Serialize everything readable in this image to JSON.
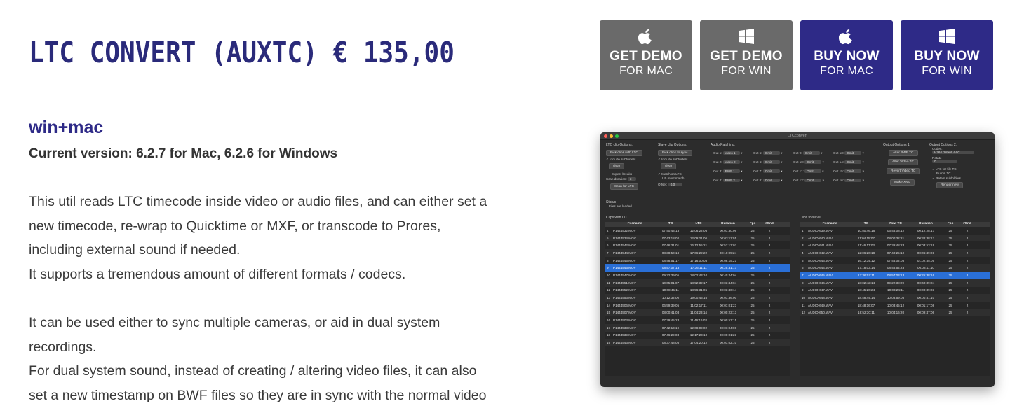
{
  "product": {
    "title": "LTC CONVERT (AUXTC) € 135,00",
    "platform": "win+mac",
    "version": "Current version: 6.2.7 for Mac, 6.2.6  for Windows"
  },
  "buttons": [
    {
      "main": "GET DEMO",
      "sub": "FOR MAC",
      "icon": "apple-icon",
      "color": "#6a6a6a"
    },
    {
      "main": "GET DEMO",
      "sub": "FOR WIN",
      "icon": "windows-icon",
      "color": "#6a6a6a"
    },
    {
      "main": "BUY NOW",
      "sub": "FOR MAC",
      "icon": "apple-icon",
      "color": "#2e2a87"
    },
    {
      "main": "BUY NOW",
      "sub": "FOR WIN",
      "icon": "windows-icon",
      "color": "#2e2a87"
    }
  ],
  "description": {
    "para1": [
      "This util reads LTC timecode inside video or audio files, and can either set a",
      "new timecode, re-wrap to Quicktime or MXF, or transcode to Prores,",
      "including external sound if needed.",
      "It supports a tremendous amount of different formats / codecs."
    ],
    "para2": [
      "It can be used either to sync multiple cameras, or aid in dual system",
      "recordings.",
      "For dual system sound, instead of creating / altering video files, it can also",
      "set a new timestamp on BWF files so they are in sync with the normal video"
    ]
  },
  "app": {
    "window_title": "LTCconvert",
    "ltc_options": {
      "label": "LTC clip Options:",
      "pick_button": "Pick clips with LTC",
      "include_subfolders": "Include subfolders",
      "clear": "clear",
      "expect_breaks": "Expect breaks",
      "scan_duration_label": "Scan duration:",
      "scan_duration_value": "3",
      "scan_button": "Scan for LTC"
    },
    "slave_options": {
      "label": "Slave clip Options:",
      "pick_button": "Pick clips to sync",
      "include_subfolders": "Include subfolders",
      "clear": "clear",
      "match_ltc": "Match on LTC",
      "ub_match": "UB must match",
      "offset_label": "Offset:",
      "offset_value": "0.0"
    },
    "audio_patching": {
      "label": "Audio Patching:",
      "outs": [
        [
          "Out 1:",
          "video 1"
        ],
        [
          "Out 2:",
          "video 2"
        ],
        [
          "Out 3:",
          "BWF 1"
        ],
        [
          "Out 4:",
          "BWF 2"
        ],
        [
          "Out 5:",
          "Omit"
        ],
        [
          "Out 6:",
          "Omit"
        ],
        [
          "Out 7:",
          "Omit"
        ],
        [
          "Out 8:",
          "Omit"
        ],
        [
          "Out 9:",
          "Omit"
        ],
        [
          "Out 10:",
          "Omit"
        ],
        [
          "Out 11:",
          "Omit"
        ],
        [
          "Out 12:",
          "Omit"
        ],
        [
          "Out 13:",
          "Omit"
        ],
        [
          "Out 14:",
          "Omit"
        ],
        [
          "Out 15:",
          "Omit"
        ],
        [
          "Out 16:",
          "Omit"
        ]
      ]
    },
    "output1": {
      "label": "Output Options 1:",
      "buttons": [
        "Alter BWF TC",
        "Alter Video TC",
        "Revert Video TC",
        "Make XML"
      ]
    },
    "output2": {
      "label": "Output Options 2:",
      "codec_label": "Codec:",
      "codec_value": "H264 default AAC",
      "rotate_label": "Rotate",
      "rotate_value": "0",
      "ltc_burnin": "LTC for file TC",
      "burnin": "Burnin TC",
      "retain": "Retain subfolders",
      "render": "Render new"
    },
    "status_label": "Status",
    "status_text": "Files are loaded",
    "left_table": {
      "label": "Clips with LTC",
      "columns": [
        "Filename",
        "TC",
        "LTC",
        "Duration",
        "Fps",
        "#Snd"
      ],
      "rows": [
        [
          "4",
          "P1444532.MOV",
          "07:40:43:13",
          "12:06:22:06",
          "00:01:30:06",
          "25",
          "2"
        ],
        [
          "5",
          "P1444534.MOV",
          "07:43:18:02",
          "12:09:21:06",
          "00:03:11:01",
          "25",
          "2"
        ],
        [
          "6",
          "P1444542.MOV",
          "07:46:31:01",
          "16:12:55:21",
          "00:51:17:07",
          "25",
          "2"
        ],
        [
          "7",
          "P1444544.MOV",
          "08:38:50:18",
          "17:06:22:22",
          "00:10:09:24",
          "25",
          "2"
        ],
        [
          "8",
          "P1444545.MOV",
          "08:48:51:17",
          "17:16:00:08",
          "00:08:15:21",
          "25",
          "2"
        ],
        [
          "9",
          "P1444546.MOV",
          "08:57:07:13",
          "17:36:11:11",
          "00:25:31:17",
          "25",
          "2"
        ],
        [
          "10",
          "P1444547.MOV",
          "09:22:39:05",
          "18:02:43:10",
          "00:40:44:04",
          "25",
          "2"
        ],
        [
          "11",
          "P1444551.MOV",
          "10:05:01:07",
          "18:52:32:17",
          "00:03:44:04",
          "25",
          "2"
        ],
        [
          "12",
          "P1444552.MOV",
          "10:08:45:11",
          "18:56:31:05",
          "00:03:46:14",
          "25",
          "2"
        ],
        [
          "13",
          "P1444553.MOV",
          "10:12:32:00",
          "19:00:45:16",
          "00:01:36:00",
          "25",
          "2"
        ],
        [
          "14",
          "P1444506.MOV",
          "06:59:39:05",
          "11:02:17:11",
          "00:01:01:23",
          "25",
          "2"
        ],
        [
          "15",
          "P1444507.MOV",
          "08:00:41:03",
          "11:04:23:14",
          "00:00:23:13",
          "25",
          "2"
        ],
        [
          "16",
          "P1444503.MOV",
          "07:39:45:23",
          "11:46:16:03",
          "00:00:57:15",
          "25",
          "2"
        ],
        [
          "17",
          "P1444533.MOV",
          "07:42:13:19",
          "12:08:09:02",
          "00:01:04:08",
          "25",
          "2"
        ],
        [
          "18",
          "P1444539.MOV",
          "07:46:29:03",
          "12:17:23:10",
          "00:00:01:23",
          "25",
          "2"
        ],
        [
          "19",
          "P1444543.MOV",
          "08:37:48:08",
          "17:04:20:12",
          "00:01:02:10",
          "25",
          "2"
        ]
      ]
    },
    "right_table": {
      "label": "Clips to slave",
      "columns": [
        "Filename",
        "TC",
        "New TC",
        "Duration",
        "Fps",
        "#Snd"
      ],
      "rows": [
        [
          "1",
          "AUDIO-639.WAV",
          "10:50:46:16",
          "06:48:08:12",
          "00:12:28:17",
          "25",
          "2"
        ],
        [
          "2",
          "AUDIO-640.WAV",
          "11:04:15:07",
          "08:00:32:21",
          "00:38:38:17",
          "25",
          "2"
        ],
        [
          "3",
          "AUDIO-641.WAV",
          "11:46:17:03",
          "07:39:48:23",
          "00:03:53:19",
          "25",
          "2"
        ],
        [
          "4",
          "AUDIO-642.WAV",
          "12:06:20:18",
          "07:40:25:10",
          "00:06:49:01",
          "25",
          "2"
        ],
        [
          "5",
          "AUDIO-643.WAV",
          "16:12:34:12",
          "07:46:02:08",
          "01:02:55:05",
          "25",
          "2"
        ],
        [
          "6",
          "AUDIO-644.WAV",
          "17:18:03:14",
          "08:48:54:23",
          "00:08:11:10",
          "25",
          "2"
        ],
        [
          "7",
          "AUDIO-645.WAV",
          "17:36:07:11",
          "08:57:03:13",
          "00:25:38:16",
          "25",
          "2"
        ],
        [
          "8",
          "AUDIO-646.WAV",
          "18:02:42:14",
          "09:22:38:09",
          "00:40:39:24",
          "25",
          "2"
        ],
        [
          "9",
          "AUDIO-647.WAV",
          "18:45:20:24",
          "10:03:24:11",
          "00:00:39:03",
          "25",
          "2"
        ],
        [
          "10",
          "AUDIO-648.WAV",
          "18:48:44:14",
          "10:03:59:08",
          "00:00:51:10",
          "25",
          "2"
        ],
        [
          "11",
          "AUDIO-649.WAV",
          "18:48:16:07",
          "10:03:45:12",
          "00:01:17:08",
          "25",
          "2"
        ],
        [
          "12",
          "AUDIO-650.WAV",
          "18:52:30:11",
          "10:04:16:20",
          "00:09:47:06",
          "25",
          "2"
        ]
      ]
    }
  }
}
